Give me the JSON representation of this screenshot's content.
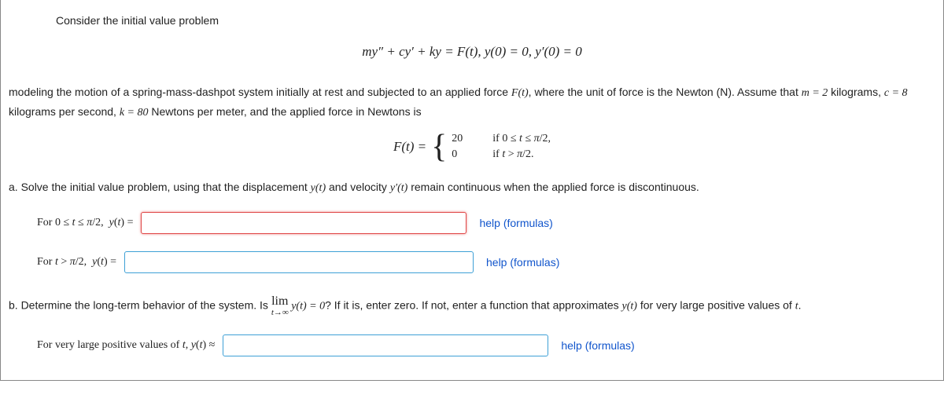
{
  "intro": "Consider the initial value problem",
  "main_equation": "my″ + cy′ + ky = F(t),   y(0) = 0,   y′(0) = 0",
  "model_text_a": "modeling the motion of a spring-mass-dashpot system initially at rest and subjected to an applied force ",
  "model_text_b": ", where the unit of force is the Newton (N). Assume that ",
  "m_val": "m = 2",
  "kilograms_text": " kilograms, ",
  "c_val": "c = 8",
  "c_unit": " kilograms per second, ",
  "k_val": "k = 80",
  "k_unit": " Newtons per meter, and the applied force in Newtons is",
  "piecewise": {
    "fn_label": "F(t) =",
    "case1_val": "20",
    "case1_cond": "if 0 ≤ t ≤ π/2,",
    "case2_val": "0",
    "case2_cond": "if t > π/2."
  },
  "part_a": {
    "text": "a. Solve the initial value problem, using that the displacement ",
    "yt": "y(t)",
    "text2": " and velocity ",
    "ypt": "y′(t)",
    "text3": " remain continuous when the applied force is discontinuous.",
    "label1_a": "For ",
    "label1_b": "0 ≤ t ≤ π/2,  y(t) =",
    "label2_a": "For ",
    "label2_b": "t > π/2,  y(t) ="
  },
  "part_b": {
    "text1": "b. Determine the long-term behavior of the system. Is ",
    "lim_top": "lim",
    "lim_bot": "t→∞",
    "lim_of": " y(t) = 0",
    "text2": "? If it is, enter zero. If not, enter a function that approximates ",
    "yt": "y(t)",
    "text3": " for very large positive values of ",
    "tvar": "t",
    "period": ".",
    "label_a": "For very large positive values of ",
    "label_b": "t, y(t) ≈"
  },
  "help_text": "help (formulas)",
  "inputs": {
    "a1": "",
    "a2": "",
    "b1": ""
  }
}
